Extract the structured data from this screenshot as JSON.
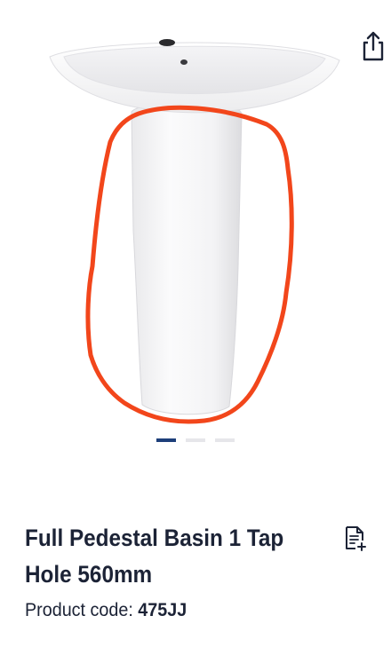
{
  "gallery": {
    "image_icon": "pedestal-basin-product-image",
    "slide_count": 3,
    "active_slide": 0,
    "annotation_color": "#f2461b"
  },
  "toolbar": {
    "share_icon": "share-icon"
  },
  "product": {
    "title": "Full Pedestal Basin 1 Tap Hole 560mm",
    "code_label": "Product code:",
    "code_value": "475JJ",
    "notes_icon": "add-note-icon"
  },
  "colors": {
    "text": "#1c2336",
    "dot_active": "#1d3f7a",
    "dot_inactive": "#e6e6ea"
  }
}
